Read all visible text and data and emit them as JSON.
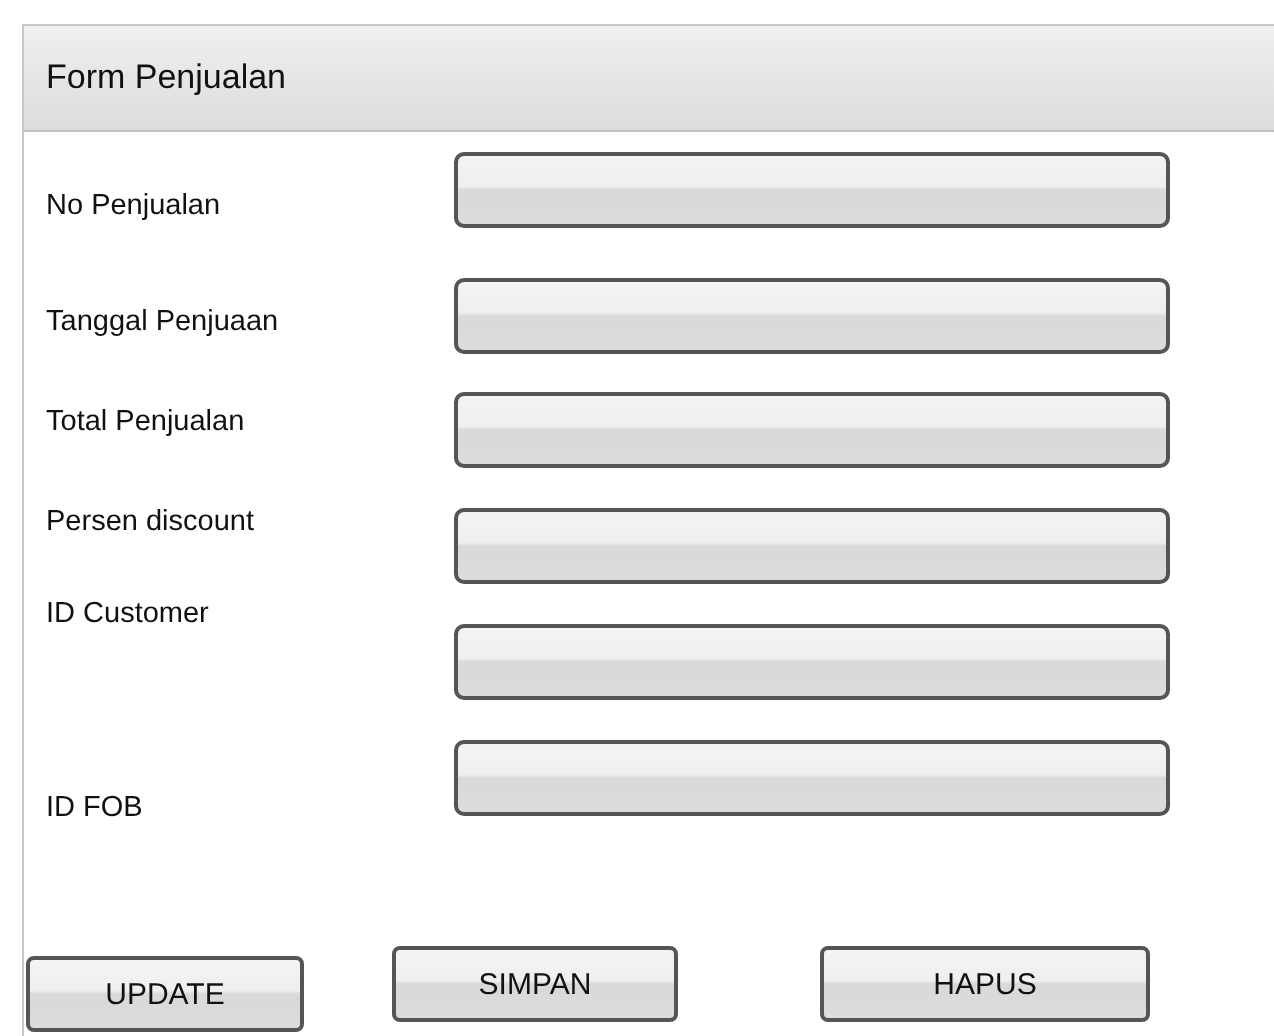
{
  "window": {
    "title": "Form Penjualan"
  },
  "fields": [
    {
      "label": "No Penjualan"
    },
    {
      "label": "Tanggal Penjuaan"
    },
    {
      "label": "Total Penjualan"
    },
    {
      "label": "Persen discount"
    },
    {
      "label": "ID Customer"
    },
    {
      "label": "ID FOB"
    }
  ],
  "buttons": [
    "UPDATE",
    "SIMPAN",
    "HAPUS"
  ]
}
